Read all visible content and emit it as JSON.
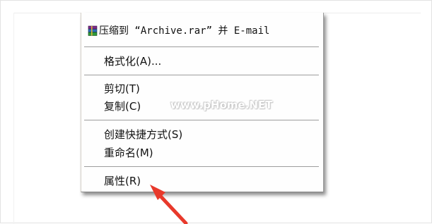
{
  "context_menu": {
    "items": [
      {
        "label": "压缩到 “Archive.rar” 并 E-mail",
        "icon": "winrar-books-icon"
      },
      {
        "label": "格式化(A)..."
      },
      {
        "label": "剪切(T)"
      },
      {
        "label": "复制(C)"
      },
      {
        "label": "创建快捷方式(S)"
      },
      {
        "label": "重命名(M)"
      },
      {
        "label": "属性(R)"
      }
    ]
  },
  "watermark": {
    "text": "www.pHome.NET"
  },
  "annotation": {
    "arrow_color": "#e8392b",
    "arrow_target": "属性(R)"
  }
}
